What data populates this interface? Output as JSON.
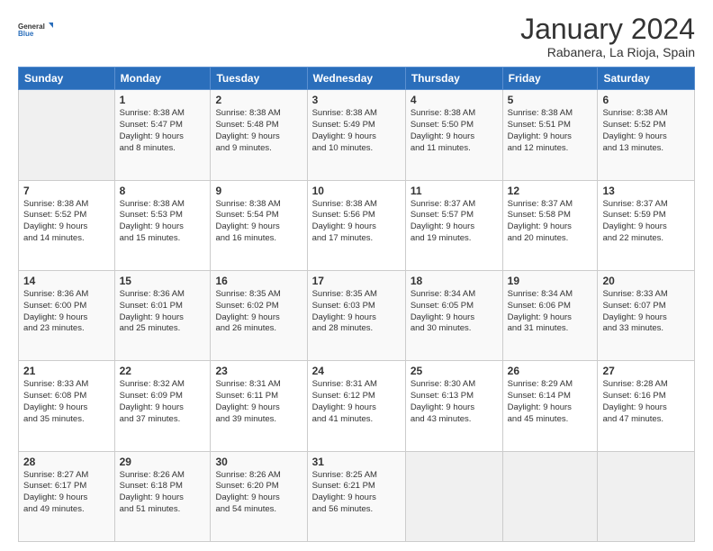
{
  "logo": {
    "line1": "General",
    "line2": "Blue"
  },
  "header": {
    "month": "January 2024",
    "location": "Rabanera, La Rioja, Spain"
  },
  "weekdays": [
    "Sunday",
    "Monday",
    "Tuesday",
    "Wednesday",
    "Thursday",
    "Friday",
    "Saturday"
  ],
  "weeks": [
    [
      {
        "day": "",
        "info": ""
      },
      {
        "day": "1",
        "info": "Sunrise: 8:38 AM\nSunset: 5:47 PM\nDaylight: 9 hours\nand 8 minutes."
      },
      {
        "day": "2",
        "info": "Sunrise: 8:38 AM\nSunset: 5:48 PM\nDaylight: 9 hours\nand 9 minutes."
      },
      {
        "day": "3",
        "info": "Sunrise: 8:38 AM\nSunset: 5:49 PM\nDaylight: 9 hours\nand 10 minutes."
      },
      {
        "day": "4",
        "info": "Sunrise: 8:38 AM\nSunset: 5:50 PM\nDaylight: 9 hours\nand 11 minutes."
      },
      {
        "day": "5",
        "info": "Sunrise: 8:38 AM\nSunset: 5:51 PM\nDaylight: 9 hours\nand 12 minutes."
      },
      {
        "day": "6",
        "info": "Sunrise: 8:38 AM\nSunset: 5:52 PM\nDaylight: 9 hours\nand 13 minutes."
      }
    ],
    [
      {
        "day": "7",
        "info": "Sunrise: 8:38 AM\nSunset: 5:52 PM\nDaylight: 9 hours\nand 14 minutes."
      },
      {
        "day": "8",
        "info": "Sunrise: 8:38 AM\nSunset: 5:53 PM\nDaylight: 9 hours\nand 15 minutes."
      },
      {
        "day": "9",
        "info": "Sunrise: 8:38 AM\nSunset: 5:54 PM\nDaylight: 9 hours\nand 16 minutes."
      },
      {
        "day": "10",
        "info": "Sunrise: 8:38 AM\nSunset: 5:56 PM\nDaylight: 9 hours\nand 17 minutes."
      },
      {
        "day": "11",
        "info": "Sunrise: 8:37 AM\nSunset: 5:57 PM\nDaylight: 9 hours\nand 19 minutes."
      },
      {
        "day": "12",
        "info": "Sunrise: 8:37 AM\nSunset: 5:58 PM\nDaylight: 9 hours\nand 20 minutes."
      },
      {
        "day": "13",
        "info": "Sunrise: 8:37 AM\nSunset: 5:59 PM\nDaylight: 9 hours\nand 22 minutes."
      }
    ],
    [
      {
        "day": "14",
        "info": "Sunrise: 8:36 AM\nSunset: 6:00 PM\nDaylight: 9 hours\nand 23 minutes."
      },
      {
        "day": "15",
        "info": "Sunrise: 8:36 AM\nSunset: 6:01 PM\nDaylight: 9 hours\nand 25 minutes."
      },
      {
        "day": "16",
        "info": "Sunrise: 8:35 AM\nSunset: 6:02 PM\nDaylight: 9 hours\nand 26 minutes."
      },
      {
        "day": "17",
        "info": "Sunrise: 8:35 AM\nSunset: 6:03 PM\nDaylight: 9 hours\nand 28 minutes."
      },
      {
        "day": "18",
        "info": "Sunrise: 8:34 AM\nSunset: 6:05 PM\nDaylight: 9 hours\nand 30 minutes."
      },
      {
        "day": "19",
        "info": "Sunrise: 8:34 AM\nSunset: 6:06 PM\nDaylight: 9 hours\nand 31 minutes."
      },
      {
        "day": "20",
        "info": "Sunrise: 8:33 AM\nSunset: 6:07 PM\nDaylight: 9 hours\nand 33 minutes."
      }
    ],
    [
      {
        "day": "21",
        "info": "Sunrise: 8:33 AM\nSunset: 6:08 PM\nDaylight: 9 hours\nand 35 minutes."
      },
      {
        "day": "22",
        "info": "Sunrise: 8:32 AM\nSunset: 6:09 PM\nDaylight: 9 hours\nand 37 minutes."
      },
      {
        "day": "23",
        "info": "Sunrise: 8:31 AM\nSunset: 6:11 PM\nDaylight: 9 hours\nand 39 minutes."
      },
      {
        "day": "24",
        "info": "Sunrise: 8:31 AM\nSunset: 6:12 PM\nDaylight: 9 hours\nand 41 minutes."
      },
      {
        "day": "25",
        "info": "Sunrise: 8:30 AM\nSunset: 6:13 PM\nDaylight: 9 hours\nand 43 minutes."
      },
      {
        "day": "26",
        "info": "Sunrise: 8:29 AM\nSunset: 6:14 PM\nDaylight: 9 hours\nand 45 minutes."
      },
      {
        "day": "27",
        "info": "Sunrise: 8:28 AM\nSunset: 6:16 PM\nDaylight: 9 hours\nand 47 minutes."
      }
    ],
    [
      {
        "day": "28",
        "info": "Sunrise: 8:27 AM\nSunset: 6:17 PM\nDaylight: 9 hours\nand 49 minutes."
      },
      {
        "day": "29",
        "info": "Sunrise: 8:26 AM\nSunset: 6:18 PM\nDaylight: 9 hours\nand 51 minutes."
      },
      {
        "day": "30",
        "info": "Sunrise: 8:26 AM\nSunset: 6:20 PM\nDaylight: 9 hours\nand 54 minutes."
      },
      {
        "day": "31",
        "info": "Sunrise: 8:25 AM\nSunset: 6:21 PM\nDaylight: 9 hours\nand 56 minutes."
      },
      {
        "day": "",
        "info": ""
      },
      {
        "day": "",
        "info": ""
      },
      {
        "day": "",
        "info": ""
      }
    ]
  ]
}
